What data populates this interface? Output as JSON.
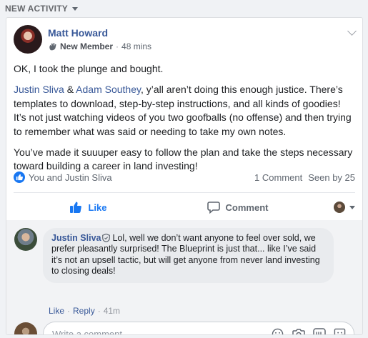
{
  "section": {
    "title": "NEW ACTIVITY"
  },
  "post": {
    "author": "Matt Howard",
    "badge": "New Member",
    "time": "48 mins",
    "paragraph1": "OK, I took the plunge and bought.",
    "mention1": "Justin Sliva",
    "amp": " & ",
    "mention2": "Adam Southey",
    "paragraph2_rest": ", y’all aren’t doing this enough justice. There’s templates to download, step-by-step instructions, and all kinds of goodies! It’s not just watching videos of you two goofballs (no offense) and then trying to remember what was said or needing to take my own notes.",
    "paragraph3": "You’ve made it suuuper easy to follow the plan and take the steps necessary toward building a career in land investing!"
  },
  "reactions": {
    "likers": "You and Justin Sliva",
    "comments": "1 Comment",
    "seen": "Seen by 25"
  },
  "actions": {
    "like_label": "Like",
    "comment_label": "Comment"
  },
  "comment": {
    "author": "Justin Sliva",
    "text": "Lol, well we don’t want anyone to feel over sold, we prefer pleasantly surprised! The Blueprint is just that... like I’ve said it’s not an upsell tactic, but will get anyone from never land investing to closing deals!",
    "like_label": "Like",
    "separator": "·",
    "reply_label": "Reply",
    "time": "41m"
  },
  "composer": {
    "placeholder": "Write a comment..."
  },
  "icons": {
    "badge": "wave-icon",
    "admin": "shield-icon",
    "tools": [
      "emoji-icon",
      "camera-icon",
      "gif-icon",
      "sticker-icon"
    ]
  },
  "colors": {
    "link": "#385898",
    "accent": "#1877f2",
    "muted": "#606770"
  }
}
